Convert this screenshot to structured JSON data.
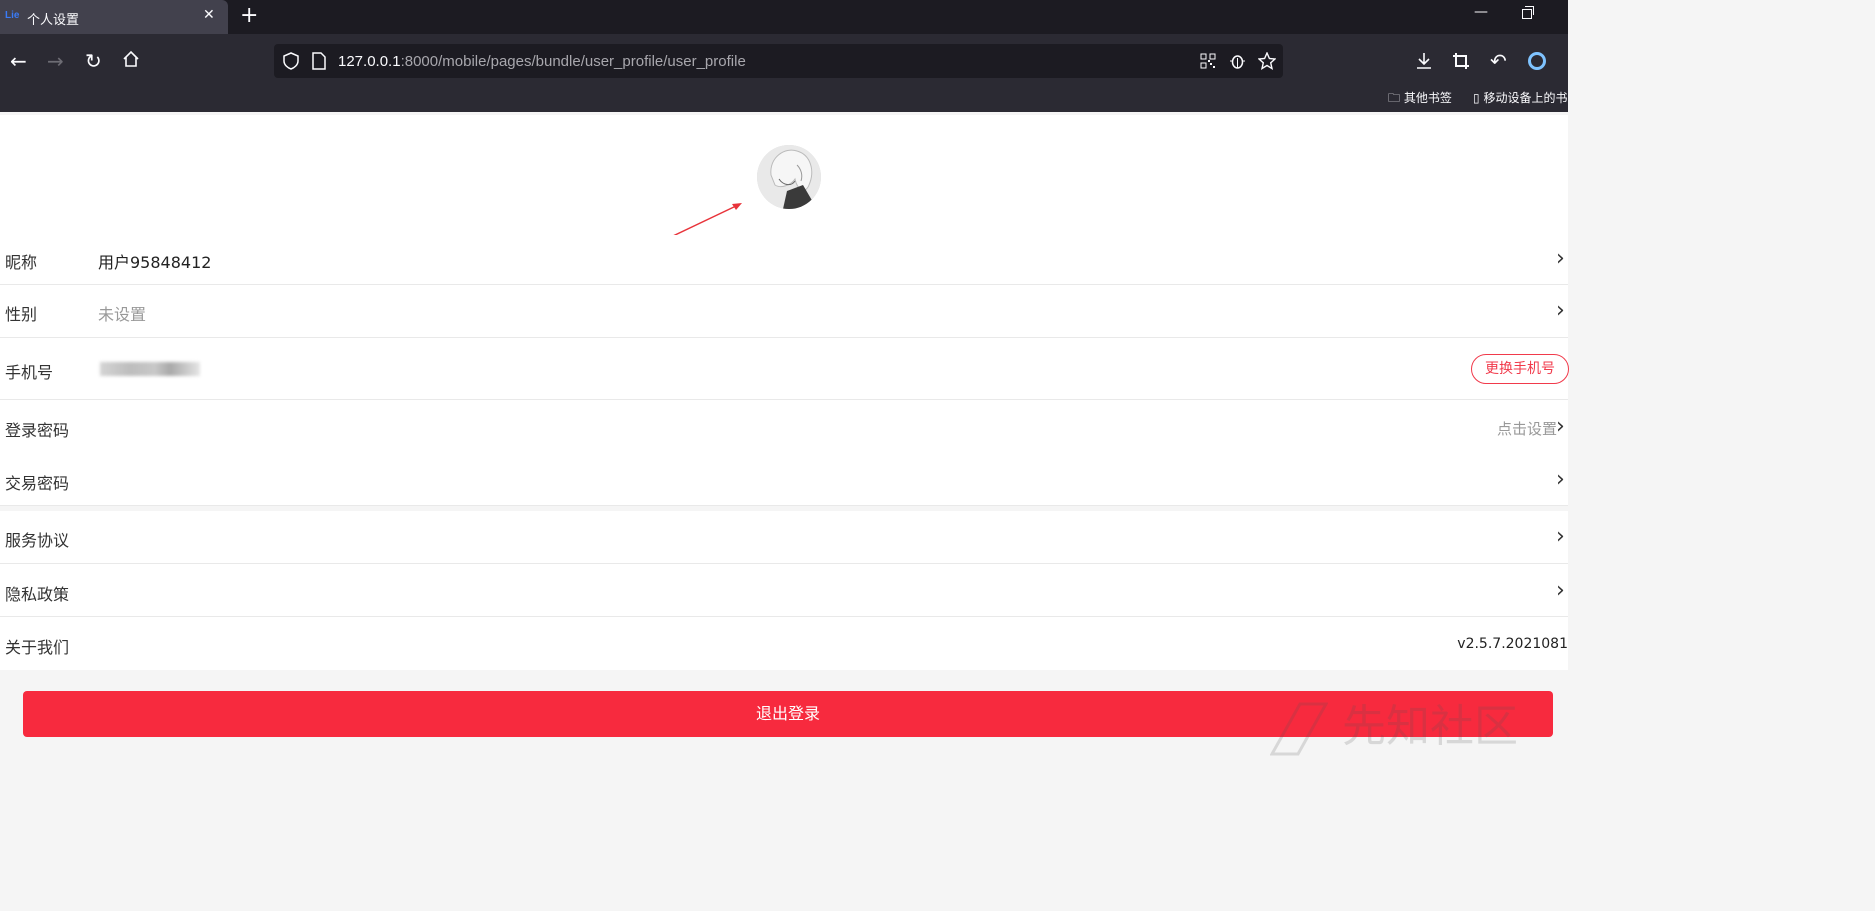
{
  "browser": {
    "tab_title": "个人设置",
    "favicon_text": "Lie",
    "url_host": "127.0.0.1",
    "url_rest": ":8000/mobile/pages/bundle/user_profile/user_profile",
    "bookmark_other": "其他书签",
    "bookmark_mobile": "移动设备上的书"
  },
  "profile": {
    "rows": [
      {
        "label": "昵称",
        "value": "用户95848412"
      },
      {
        "label": "性别",
        "value": "未设置"
      },
      {
        "label": "手机号",
        "button": "更换手机号"
      },
      {
        "label": "登录密码",
        "hint": "点击设置"
      },
      {
        "label": "交易密码"
      },
      {
        "label": "服务协议"
      },
      {
        "label": "隐私政策"
      },
      {
        "label": "关于我们",
        "version": "v2.5.7.2021081"
      }
    ],
    "logout_label": "退出登录"
  },
  "watermark": "先知社区",
  "colors": {
    "accent": "#f72a3e",
    "chrome_dark": "#1c1b22",
    "chrome_mid": "#2b2a33"
  }
}
